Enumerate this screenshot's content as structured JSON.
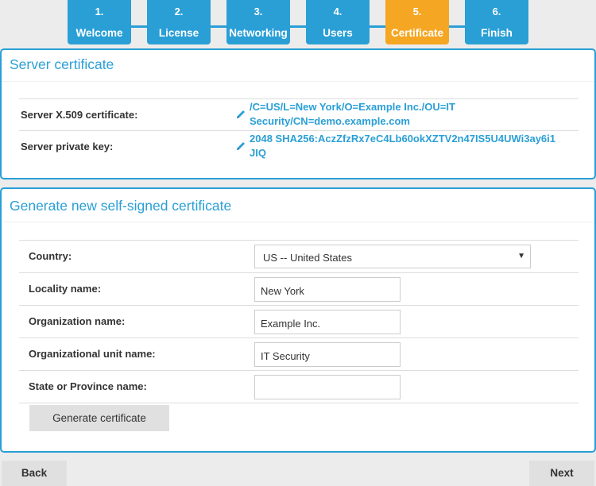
{
  "wizard": {
    "steps": [
      {
        "num": "1.",
        "label": "Welcome"
      },
      {
        "num": "2.",
        "label": "License"
      },
      {
        "num": "3.",
        "label": "Networking"
      },
      {
        "num": "4.",
        "label": "Users"
      },
      {
        "num": "5.",
        "label": "Certificate"
      },
      {
        "num": "6.",
        "label": "Finish"
      }
    ],
    "active_step": "Certificate"
  },
  "server_certificate": {
    "title": "Server certificate",
    "rows": [
      {
        "label": "Server X.509 certificate:",
        "value": "/C=US/L=New York/O=Example Inc./OU=IT Security/CN=demo.example.com"
      },
      {
        "label": "Server private key:",
        "value": "2048 SHA256:AczZfzRx7eC4Lb60okXZTV2n47IS5U4UWi3ay6i1JIQ"
      }
    ]
  },
  "self_signed": {
    "title": "Generate new self-signed certificate",
    "country": {
      "label": "Country:",
      "value": "US -- United States"
    },
    "locality": {
      "label": "Locality name:",
      "value": "New York"
    },
    "organization": {
      "label": "Organization name:",
      "value": "Example Inc."
    },
    "org_unit": {
      "label": "Organizational unit name:",
      "value": "IT Security"
    },
    "state": {
      "label": "State or Province name:",
      "value": ""
    },
    "generate_button": "Generate certificate"
  },
  "footer": {
    "back": "Back",
    "next": "Next"
  },
  "colors": {
    "accent": "#2a9fd6",
    "active_step": "#f5a623"
  }
}
